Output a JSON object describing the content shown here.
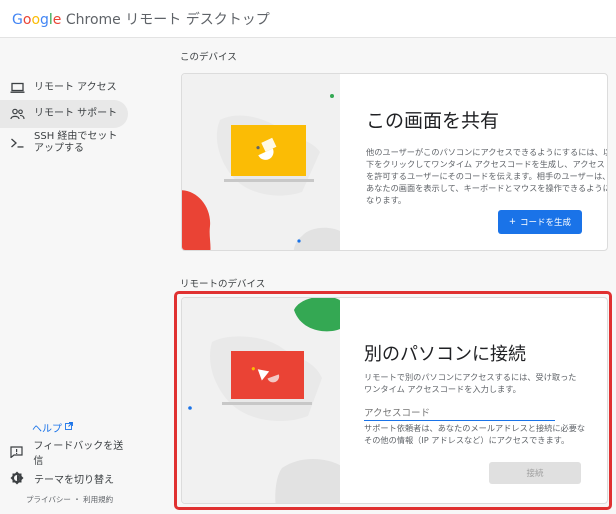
{
  "app": {
    "logo_g": "G",
    "logo_o1": "o",
    "logo_o2": "o",
    "logo_g2": "g",
    "logo_l": "l",
    "logo_e": "e",
    "title_rest": "Chrome リモート デスクトップ"
  },
  "sidebar": {
    "items": [
      {
        "label": "リモート アクセス",
        "icon": "laptop-icon",
        "active": false
      },
      {
        "label": "リモート サポート",
        "icon": "people-icon",
        "active": true
      },
      {
        "label": "SSH 経由でセットアップする",
        "icon": "terminal-icon",
        "active": false
      }
    ],
    "help": "ヘルプ",
    "feedback": "フィードバックを送信",
    "theme": "テーマを切り替え",
    "legal": "プライバシー ・ 利用規約"
  },
  "this_device": {
    "section_label": "このデバイス",
    "title": "この画面を共有",
    "description": "他のユーザーがこのパソコンにアクセスできるようにするには、以下をクリックしてワンタイム アクセスコードを生成し、アクセスを許可するユーザーにそのコードを伝えます。相手のユーザーは、あなたの画面を表示して、キーボードとマウスを操作できるようになります。",
    "button": "コードを生成"
  },
  "remote_device": {
    "section_label": "リモートのデバイス",
    "title": "別のパソコンに接続",
    "description": "リモートで別のパソコンにアクセスするには、受け取ったワンタイム アクセスコードを入力します。",
    "input_placeholder": "アクセスコード",
    "support_text": "サポート依頼者は、あなたのメールアドレスと接続に必要なその他の情報（IP アドレスなど）にアクセスできます。",
    "button": "接続"
  },
  "colors": {
    "accent": "#1a73e8",
    "share_screen": "#fbbc05",
    "connect_screen": "#ea4335",
    "highlight": "#e03131",
    "blob_green": "#34a853"
  }
}
